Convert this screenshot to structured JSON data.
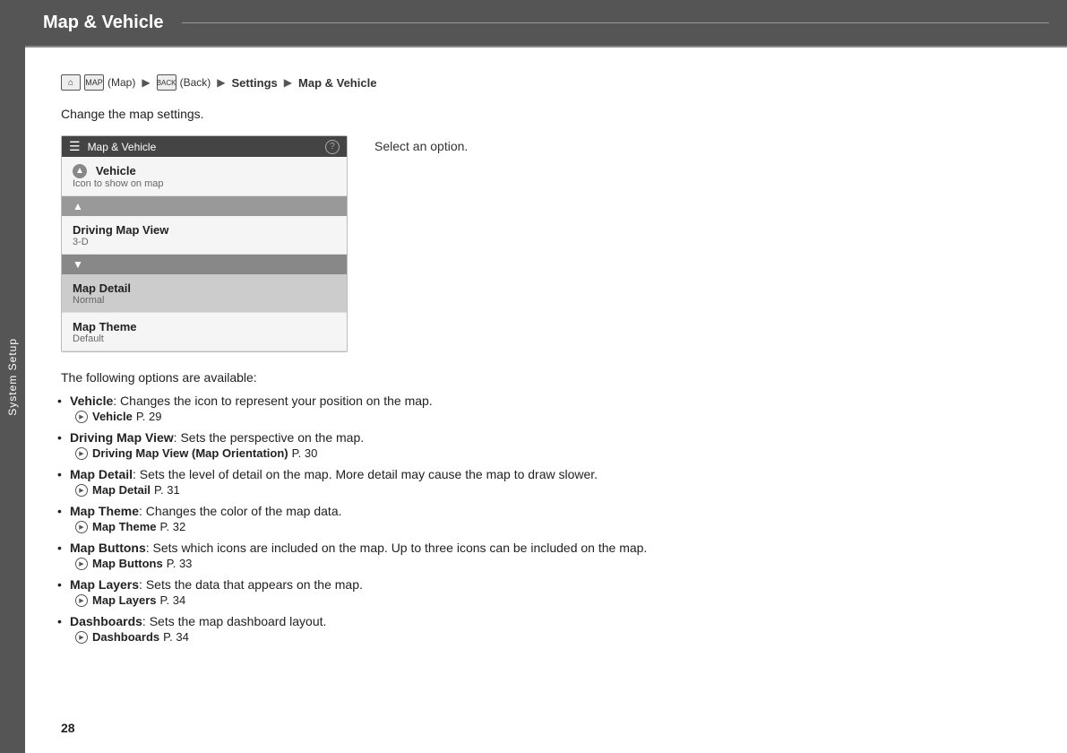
{
  "sidebar": {
    "label": "System Setup"
  },
  "header": {
    "title": "Map & Vehicle"
  },
  "breadcrumb": {
    "home_icon": "⌂",
    "map_icon": "MAP",
    "map_label": "(Map)",
    "back_icon": "BACK",
    "back_label": "(Back)",
    "settings": "Settings",
    "current": "Map & Vehicle",
    "arrow": "▶"
  },
  "intro": "Change the map settings.",
  "screen": {
    "title": "Map & Vehicle",
    "rows": [
      {
        "title": "Vehicle",
        "sub": "Icon to show on map",
        "selected": false,
        "has_icon": true
      },
      {
        "title": "Driving Map View",
        "sub": "3-D",
        "selected": false,
        "has_arrow_up": true
      },
      {
        "title": "Map Detail",
        "sub": "Normal",
        "selected": true
      },
      {
        "title": "Map Theme",
        "sub": "Default",
        "selected": false
      }
    ]
  },
  "select_text": "Select an option.",
  "options_title": "The following options are available:",
  "options": [
    {
      "name": "Vehicle",
      "desc": ": Changes the icon to represent your position on the map.",
      "ref_text": "Vehicle",
      "ref_page": "P. 29"
    },
    {
      "name": "Driving Map View",
      "desc": ": Sets the perspective on the map.",
      "ref_text": "Driving Map View (Map Orientation)",
      "ref_page": "P. 30"
    },
    {
      "name": "Map Detail",
      "desc": ": Sets the level of detail on the map. More detail may cause the map to draw slower.",
      "ref_text": "Map Detail",
      "ref_page": "P. 31"
    },
    {
      "name": "Map Theme",
      "desc": ": Changes the color of the map data.",
      "ref_text": "Map Theme",
      "ref_page": "P. 32"
    },
    {
      "name": "Map Buttons",
      "desc": ": Sets which icons are included on the map. Up to three icons can be included on the map.",
      "ref_text": "Map Buttons",
      "ref_page": "P. 33"
    },
    {
      "name": "Map Layers",
      "desc": ": Sets the data that appears on the map.",
      "ref_text": "Map Layers",
      "ref_page": "P. 34"
    },
    {
      "name": "Dashboards",
      "desc": ": Sets the map dashboard layout.",
      "ref_text": "Dashboards",
      "ref_page": "P. 34"
    }
  ],
  "page_number": "28"
}
